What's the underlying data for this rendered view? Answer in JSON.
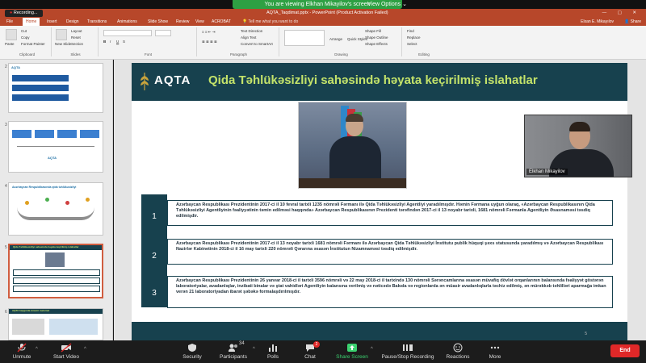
{
  "zoom": {
    "viewing_banner": "You are viewing Elkhan Mikayilov's screen",
    "view_options": "View Options",
    "recording_label": "Recording..."
  },
  "ppt": {
    "window_title": "AQTA_Taqdimat.pptx - PowerPoint (Product Activation Failed)",
    "user_name": "Elxan E. Mikayılov",
    "share_label": "Share",
    "tabs": [
      "File",
      "Home",
      "Insert",
      "Design",
      "Transitions",
      "Animations",
      "Slide Show",
      "Review",
      "View",
      "ACROBAT"
    ],
    "tell_me": "Tell me what you want to do",
    "ribbon": {
      "paste": "Paste",
      "cut": "Cut",
      "copy": "Copy",
      "format_painter": "Format Painter",
      "new_slide": "New Slide",
      "layout": "Layout",
      "reset": "Reset",
      "section": "Section",
      "text_direction": "Text Direction",
      "align_text": "Align Text",
      "convert_smartart": "Convert to SmartArt",
      "shape_fill": "Shape Fill",
      "shape_outline": "Shape Outline",
      "shape_effects": "Shape Effects",
      "find": "Find",
      "replace": "Replace",
      "select": "Select",
      "arrange": "Arrange",
      "quick_styles": "Quick Styles",
      "group_clipboard": "Clipboard",
      "group_slides": "Slides",
      "group_font": "Font",
      "group_paragraph": "Paragraph",
      "group_drawing": "Drawing",
      "group_editing": "Editing"
    }
  },
  "thumbnails": [
    {
      "num": "2",
      "title": "AQTA"
    },
    {
      "num": "3",
      "title": "AQTA"
    },
    {
      "num": "4",
      "title": "Azərbaycan Respublikasında qida təhlükəsizliyi"
    },
    {
      "num": "5",
      "title": "Qida Təhlükəsizliyi sahəsində həyata keçirilmiş islahatlar"
    },
    {
      "num": "6",
      "title": "AQTA haqqında ümumi məlumat"
    }
  ],
  "slide": {
    "logo": "AQTA",
    "title": "Qida Təhlükəsizliyi sahəsində həyata keçirilmiş islahatlar",
    "page": "5",
    "items": [
      {
        "num": "1",
        "text": "Azərbaycan Respublikası Prezidentinin 2017-ci il 10 fevral tarixli 1235 nömrəli Fərmanı ilə Qida Təhlükəsizliyi Agentliyi yaradılmışdır. Həmin Fərmana uyğun olaraq, «Azərbaycan Respublikasının Qida Təhlükəsizliyi Agentliyinin fəaliyyətinin təmin edilməsi haqqında» Azərbaycan Respublikasının Prezidenti tərəfindən 2017-ci il 13 noyabr tarixli, 1681 nömrəli Fərmanla Agentliyin Əsasnaməsi təsdiq edilmişdir."
      },
      {
        "num": "2",
        "text": "Azərbaycan Respublikası Prezidentinin 2017-ci il 13 noyabr tarixli 1681 nömrəli Fərmanı ilə Azərbaycan Qida Təhlükəsizliyi İnstitutu publik hüquqi şəxs statusunda yaradılmış və Azərbaycan Respublikası Nazirlər Kabinetinin 2018-ci il 16 may tarixli 220 nömrəli Qərarına əsasən İnstitutun Nizamnaməsi təsdiq edilmişdir."
      },
      {
        "num": "3",
        "text": "Azərbaycan Respublikası Prezidentinin 26 yanvar 2018-ci il tarixli 3596 nömrəli və 22 may 2018-ci il tarixində 130 nömrəli Sərəncamlarına əsasən müvafiq dövlət orqanlarının balansında fəaliyyət göstərən laboratoriyalar, avadanlıqlar, inzibati binalar və ştat vahidləri Agentliyin balansına verilmiş və nəticədə Bakıda və regionlarda ən müasir avadanlıqlarla təchiz edilmiş, ən mürəkkəb təhlilləri aparmağa imkan verən 21 laboratoriyadan ibarət şəbəkə formalaşdırılmışdır."
      }
    ]
  },
  "participant": {
    "name": "Elkhan Mikayilov"
  },
  "toolbar": {
    "unmute": "Unmute",
    "start_video": "Start Video",
    "security": "Security",
    "participants": "Participants",
    "participants_count": "34",
    "polls": "Polls",
    "chat": "Chat",
    "chat_badge": "2",
    "share_screen": "Share Screen",
    "record": "Pause/Stop Recording",
    "reactions": "Reactions",
    "more": "More",
    "end": "End"
  },
  "colors": {
    "slide_dark": "#17414e",
    "title_green": "#c4e36a",
    "ppt_red": "#b7472a",
    "share_green": "#3bd16f",
    "end_red": "#e02828"
  }
}
